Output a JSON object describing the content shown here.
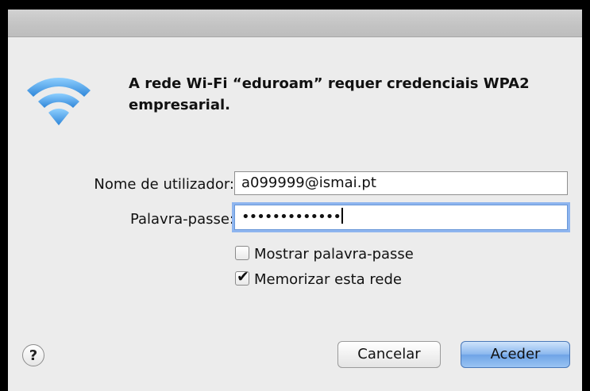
{
  "dialog": {
    "message": "A rede Wi-Fi “eduroam” requer credenciais WPA2 empresarial.",
    "icon": "wifi-icon"
  },
  "form": {
    "username_label": "Nome de utilizador:",
    "username_value": "a099999@ismai.pt",
    "password_label": "Palavra-passe:",
    "password_masked": "•••••••••••••",
    "show_password_label": "Mostrar palavra-passe",
    "show_password_checked": false,
    "remember_label": "Memorizar esta rede",
    "remember_checked": true
  },
  "buttons": {
    "help": "?",
    "cancel": "Cancelar",
    "ok": "Aceder"
  },
  "colors": {
    "accent": "#6ea3e6",
    "wifi": "#5aa8ea",
    "focus_ring": "#8eb5ef"
  }
}
